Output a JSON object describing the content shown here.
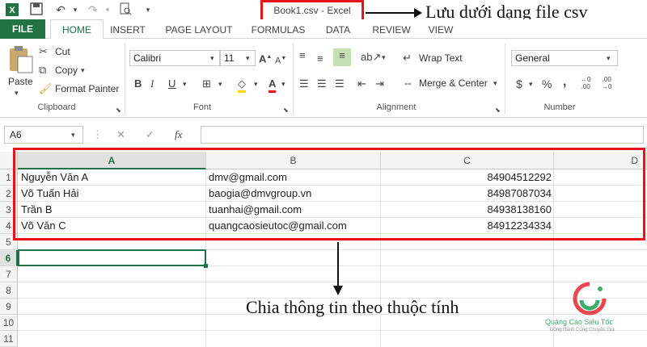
{
  "title_bar": {
    "window_title": "Book1.csv - Excel"
  },
  "tabs": [
    "FILE",
    "HOME",
    "INSERT",
    "PAGE LAYOUT",
    "FORMULAS",
    "DATA",
    "REVIEW",
    "VIEW"
  ],
  "clipboard": {
    "paste": "Paste",
    "cut": "Cut",
    "copy": "Copy",
    "format_painter": "Format Painter",
    "label": "Clipboard"
  },
  "font": {
    "family": "Calibri",
    "size": "11",
    "label": "Font"
  },
  "alignment": {
    "wrap_text": "Wrap Text",
    "merge_center": "Merge & Center",
    "label": "Alignment"
  },
  "number": {
    "format": "General",
    "currency": "$",
    "percent": "%",
    "comma": ",",
    "label": "Number"
  },
  "formula_bar": {
    "name_box": "A6",
    "fx": "fx",
    "value": ""
  },
  "columns": [
    "A",
    "B",
    "C",
    "D"
  ],
  "rows": [
    "1",
    "2",
    "3",
    "4",
    "5",
    "6",
    "7",
    "8",
    "9",
    "10",
    "11"
  ],
  "cells": [
    {
      "a": "Nguyễn Văn A",
      "b": "dmv@gmail.com",
      "c": "84904512292"
    },
    {
      "a": "Võ Tuấn Hải",
      "b": "baogia@dmvgroup.vn",
      "c": "84987087034"
    },
    {
      "a": "Trần B",
      "b": "tuanhai@gmail.com",
      "c": "84938138160"
    },
    {
      "a": "Võ Văn C",
      "b": "quangcaosieutoc@gmail.com",
      "c": "84912234334"
    }
  ],
  "annotations": {
    "top": "Lưu dưới dạng file csv",
    "bottom": "Chia thông tin theo thuộc tính"
  },
  "watermark": {
    "name": "Quảng Cáo Siêu Tốc",
    "tagline": "Đồng Hành Cùng Chuyên Gia"
  },
  "colors": {
    "excel_green": "#217346",
    "highlight_red": "#e8141c"
  }
}
